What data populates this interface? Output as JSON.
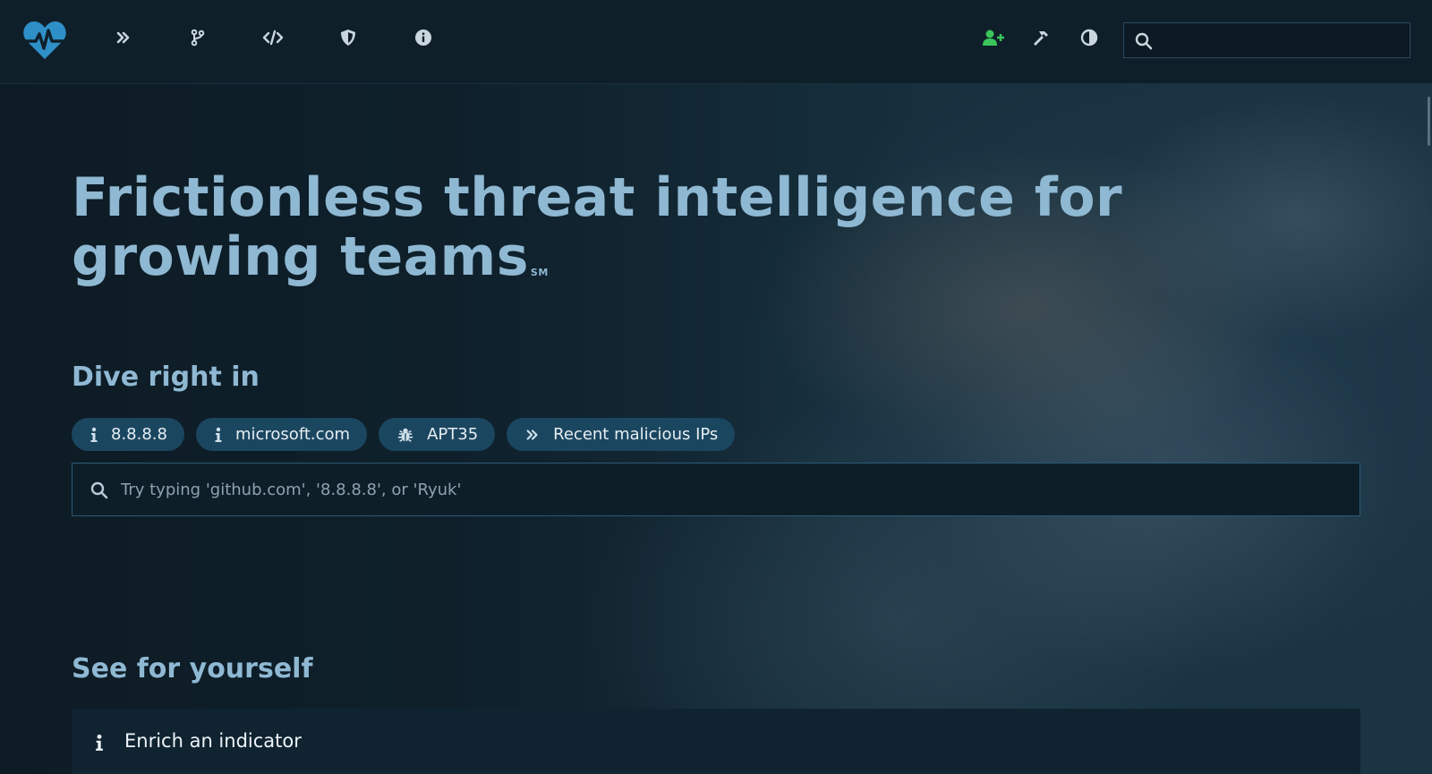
{
  "topbar": {
    "icons": [
      "heartbeat-logo-icon",
      "double-chevron-icon",
      "code-branch-icon",
      "code-icon",
      "shield-icon",
      "info-circle-icon",
      "user-plus-icon",
      "hammer-icon",
      "contrast-icon"
    ],
    "search": {
      "value": "",
      "placeholder": ""
    }
  },
  "hero": {
    "headline": "Frictionless threat intelligence for growing teams",
    "headline_mark": "SM",
    "dive_heading": "Dive right in",
    "pills": [
      {
        "label": "8.8.8.8",
        "icon": "info-icon"
      },
      {
        "label": "microsoft.com",
        "icon": "info-icon"
      },
      {
        "label": "APT35",
        "icon": "bug-icon"
      },
      {
        "label": "Recent malicious IPs",
        "icon": "double-chevron-icon"
      }
    ],
    "search_placeholder": "Try typing 'github.com', '8.8.8.8', or 'Ryuk'",
    "see_heading": "See for yourself",
    "card": {
      "label": "Enrich an indicator",
      "icon": "info-icon"
    }
  },
  "colors": {
    "accent": "#8fb8d3",
    "pill_bg": "#1b4660",
    "topbar_bg": "#0f1f29",
    "user_plus": "#3ac45a"
  }
}
